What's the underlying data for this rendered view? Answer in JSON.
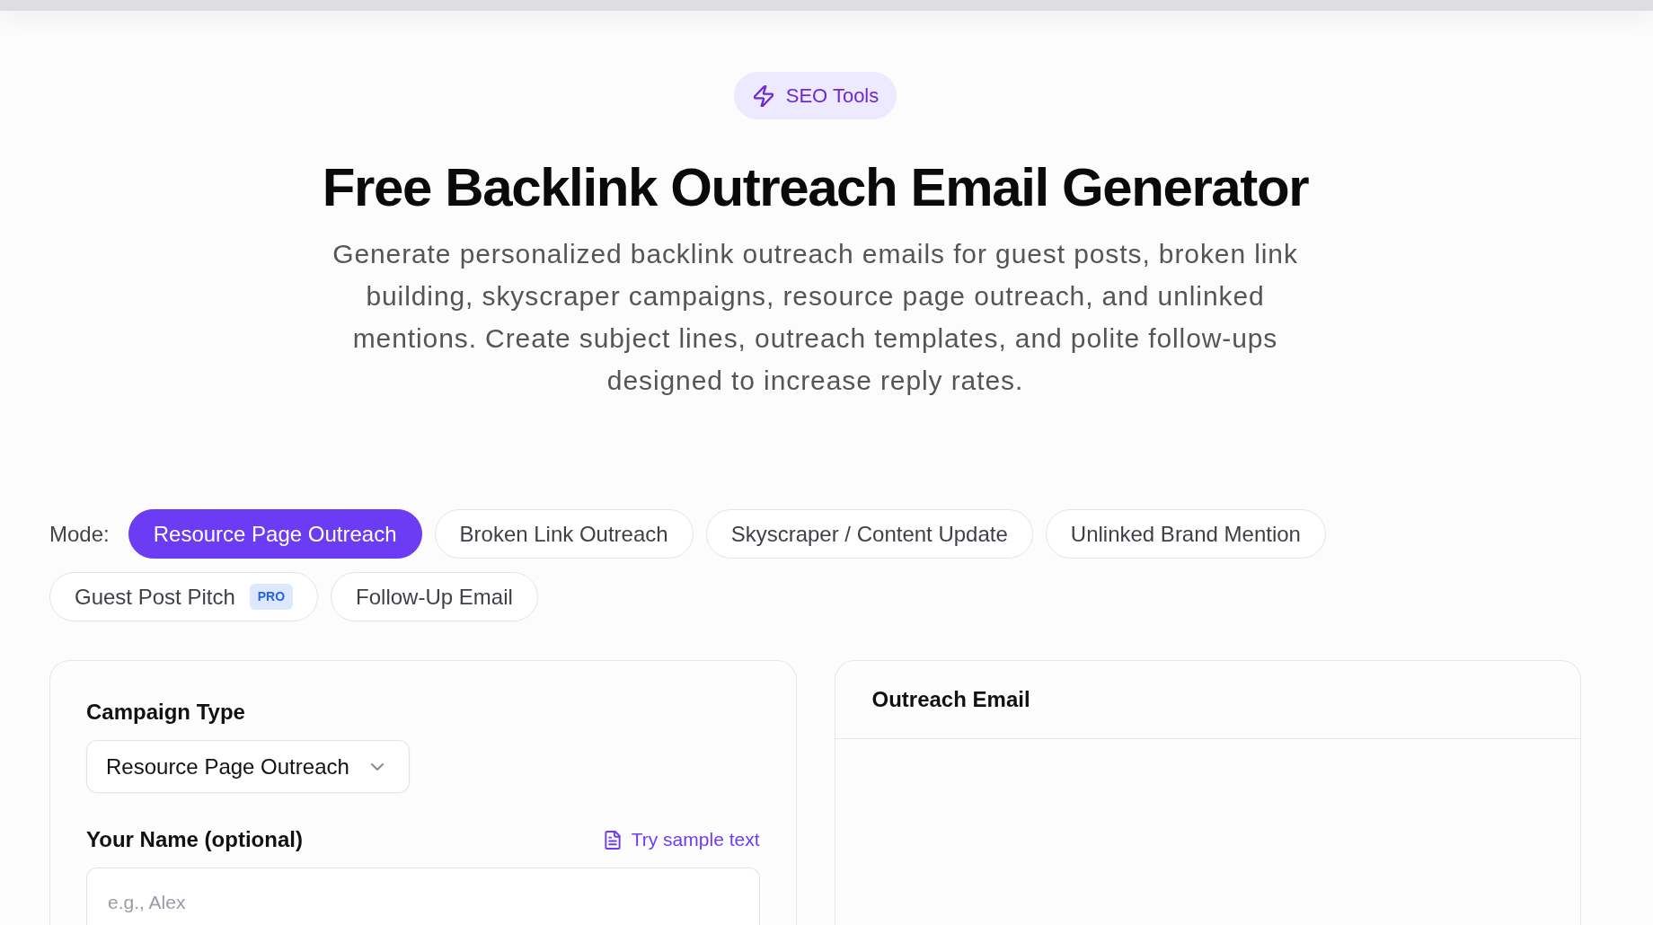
{
  "badge": {
    "label": "SEO Tools"
  },
  "title": "Free Backlink Outreach Email Generator",
  "description": "Generate personalized backlink outreach emails for guest posts, broken link building, skyscraper campaigns, resource page outreach, and unlinked mentions. Create subject lines, outreach templates, and polite follow-ups designed to increase reply rates.",
  "mode": {
    "label": "Mode:",
    "options": [
      {
        "label": "Resource Page Outreach",
        "selected": true
      },
      {
        "label": "Broken Link Outreach",
        "selected": false
      },
      {
        "label": "Skyscraper / Content Update",
        "selected": false
      },
      {
        "label": "Unlinked Brand Mention",
        "selected": false
      },
      {
        "label": "Guest Post Pitch",
        "selected": false,
        "tag": "PRO"
      },
      {
        "label": "Follow-Up Email",
        "selected": false
      }
    ]
  },
  "form": {
    "fields": [
      {
        "kind": "select",
        "label": "Campaign Type",
        "value": "Resource Page Outreach"
      },
      {
        "kind": "text",
        "label": "Your Name (optional)",
        "placeholder": "e.g., Alex",
        "action": "Try sample text"
      }
    ]
  },
  "output": {
    "title": "Outreach Email"
  }
}
